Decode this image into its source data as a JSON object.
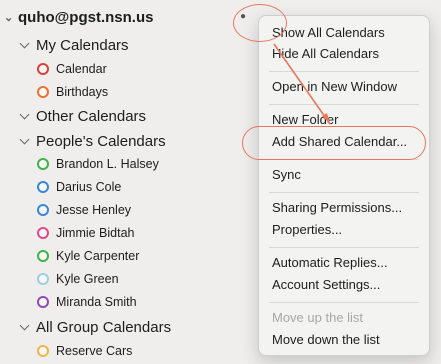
{
  "account": {
    "email": "quho@pgst.nsn.us"
  },
  "groups": [
    {
      "label": "My Calendars"
    },
    {
      "label": "Other Calendars"
    },
    {
      "label": "People's Calendars"
    },
    {
      "label": "All Group Calendars"
    }
  ],
  "my_calendars": [
    {
      "label": "Calendar",
      "color": "#d9403a"
    },
    {
      "label": "Birthdays",
      "color": "#e8732d"
    }
  ],
  "people_calendars": [
    {
      "label": "Brandon L. Halsey",
      "color": "#3fb24a"
    },
    {
      "label": "Darius Cole",
      "color": "#3a86d9"
    },
    {
      "label": "Jesse Henley",
      "color": "#3a86d9"
    },
    {
      "label": "Jimmie Bidtah",
      "color": "#e04a8d"
    },
    {
      "label": "Kyle Carpenter",
      "color": "#3fb24a"
    },
    {
      "label": "Kyle Green",
      "color": "#9ccfe0"
    },
    {
      "label": "Miranda Smith",
      "color": "#8f4bb3"
    }
  ],
  "group_calendars": [
    {
      "label": "Reserve Cars",
      "color": "#f0b54a"
    }
  ],
  "context_menu": {
    "items": [
      "Show All Calendars",
      "Hide All Calendars",
      "Open in New Window",
      "New Folder",
      "Add Shared Calendar...",
      "Sync",
      "Sharing Permissions...",
      "Properties...",
      "Automatic Replies...",
      "Account Settings...",
      "Move up the list",
      "Move down the list"
    ],
    "disabled": [
      "Move up the list"
    ]
  },
  "highlight_color": "#e9765d"
}
